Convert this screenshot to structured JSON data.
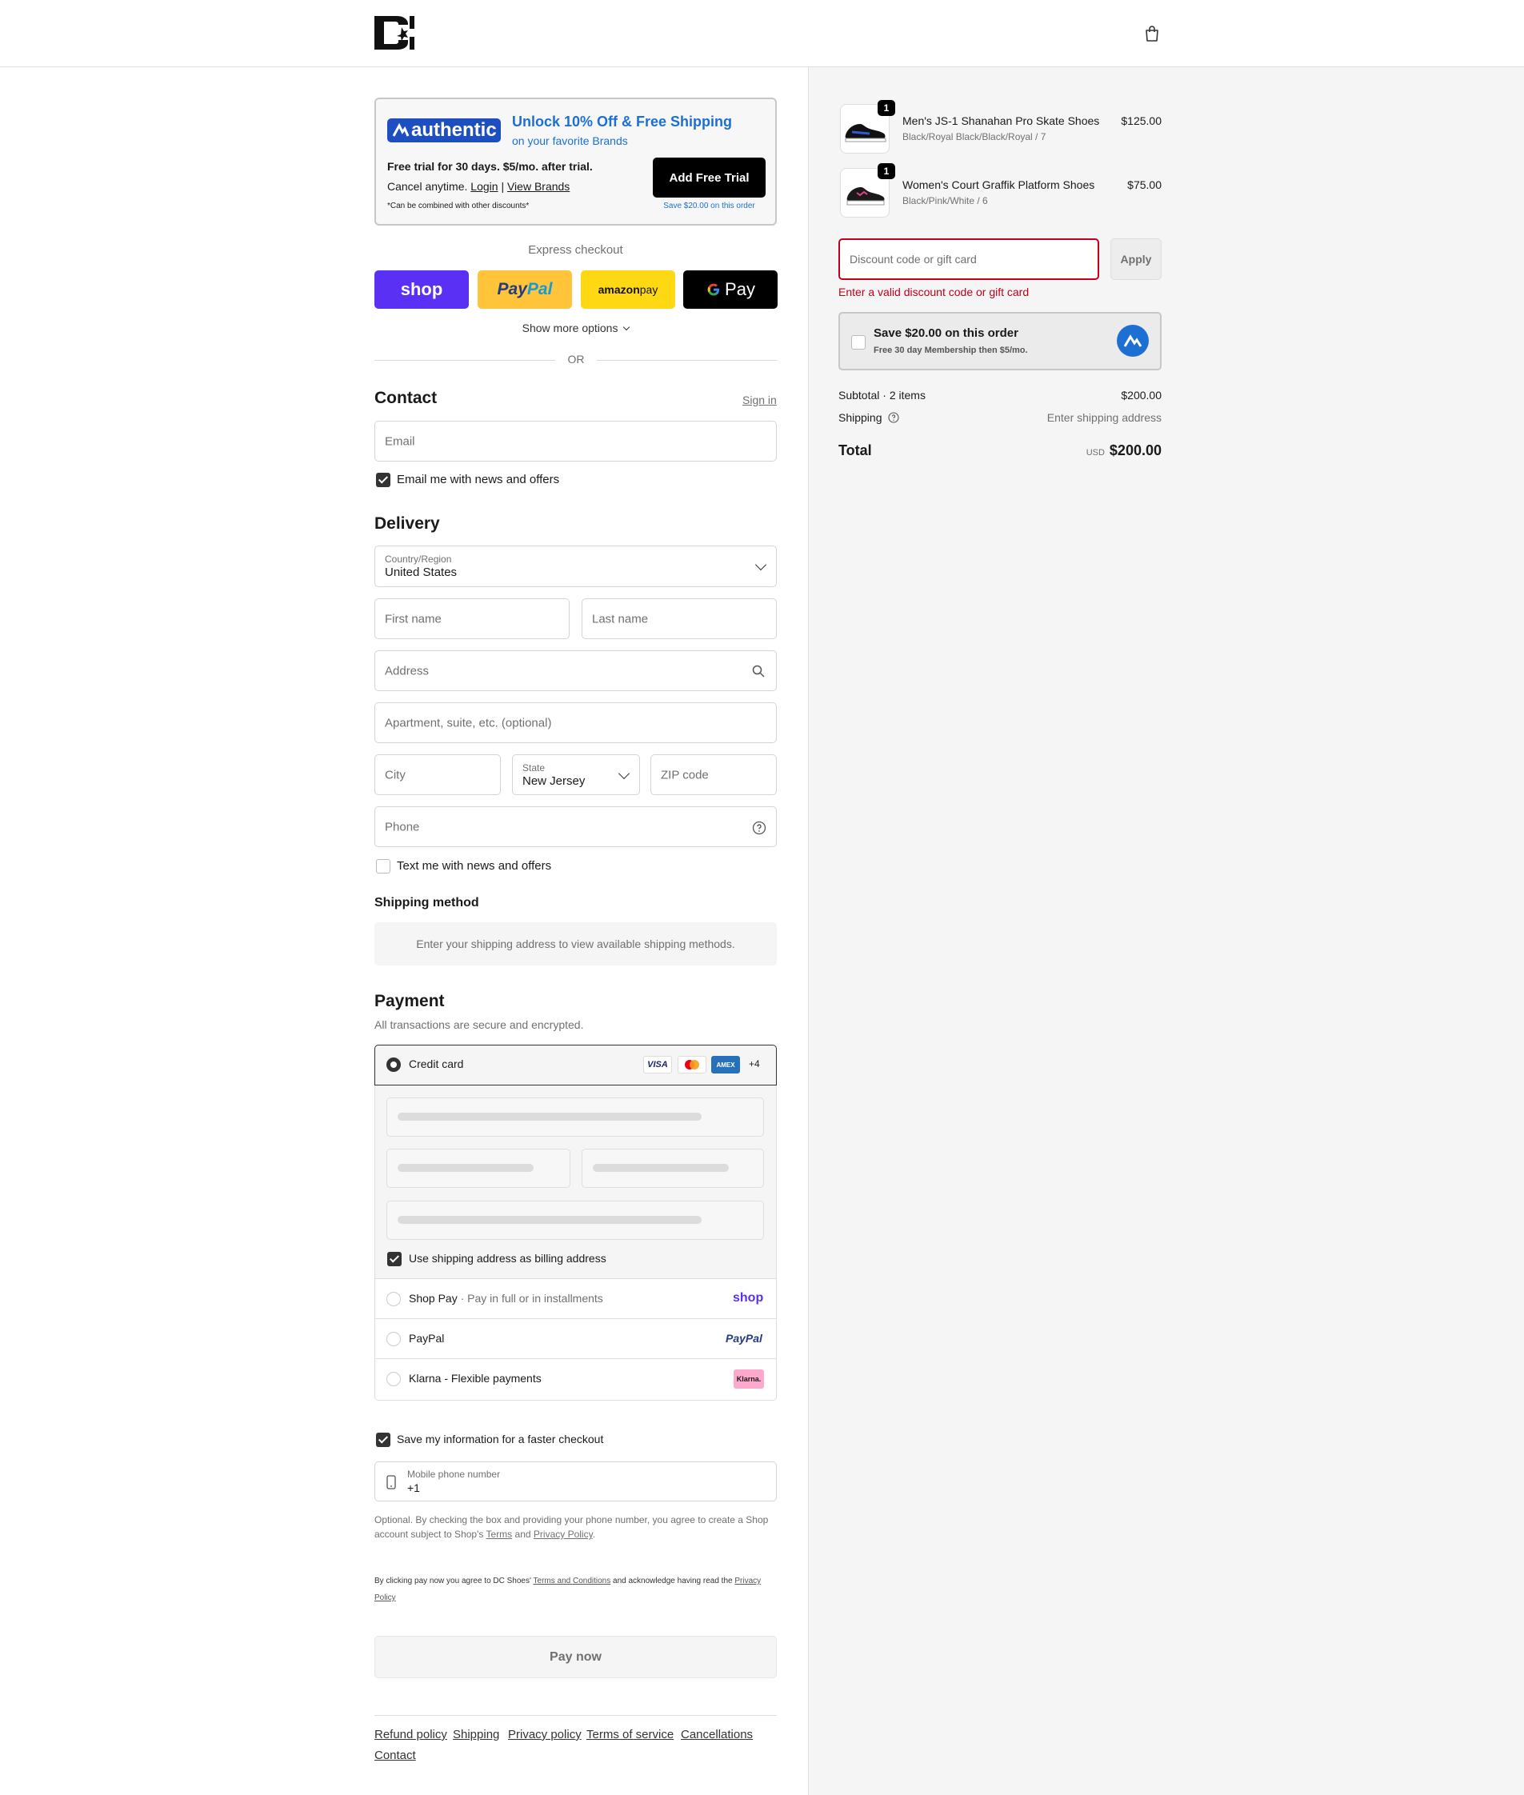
{
  "colors": {
    "accent": "#1d6fd4",
    "shop": "#5a31f4",
    "paypal": "#ffc439",
    "amazon": "#ffd814",
    "error": "#c0001a"
  },
  "header": {
    "logo_icon": "dc-logo",
    "bag_icon": "shopping-bag-icon"
  },
  "promo": {
    "logo_text": "authentic",
    "title": "Unlock 10% Off & Free Shipping",
    "subtitle": "on your favorite Brands",
    "line1": "Free trial for 30 days. $5/mo. after trial.",
    "line2_prefix": "Cancel anytime.",
    "login": "Login",
    "sep": "|",
    "view_brands": "View Brands",
    "note": "*Can be combined with other discounts*",
    "button": "Add Free Trial",
    "save_note": "Save $20.00 on this order"
  },
  "express": {
    "label": "Express checkout",
    "shop": "shop",
    "paypal_a": "Pay",
    "paypal_b": "Pal",
    "amazon_a": "amazon",
    "amazon_b": " pay",
    "gpay": "Pay",
    "show_more": "Show more options",
    "or": "OR"
  },
  "contact": {
    "heading": "Contact",
    "sign_in": "Sign in",
    "email_placeholder": "Email",
    "news_label": "Email me with news and offers",
    "news_checked": true
  },
  "delivery": {
    "heading": "Delivery",
    "country_label": "Country/Region",
    "country_value": "United States",
    "first_name": "First name",
    "last_name": "Last name",
    "address": "Address",
    "apartment": "Apartment, suite, etc. (optional)",
    "city": "City",
    "state_label": "State",
    "state_value": "New Jersey",
    "zip": "ZIP code",
    "phone": "Phone",
    "text_label": "Text me with news and offers",
    "text_checked": false
  },
  "shipping_method": {
    "heading": "Shipping method",
    "notice": "Enter your shipping address to view available shipping methods."
  },
  "payment": {
    "heading": "Payment",
    "subtitle": "All transactions are secure and encrypted.",
    "credit_card": "Credit card",
    "cards": [
      "VISA",
      "MC",
      "AMEX"
    ],
    "more_cards": "+4",
    "billing_label": "Use shipping address as billing address",
    "billing_checked": true,
    "shop_pay": "Shop Pay",
    "shop_pay_desc": "Pay in full or in installments",
    "shop_pay_logo": "shop",
    "paypal": "PayPal",
    "paypal_logo": "PayPal",
    "klarna": "Klarna - Flexible payments",
    "klarna_logo": "Klarna."
  },
  "save_info": {
    "label": "Save my information for a faster checkout",
    "checked": true,
    "mobile_label": "Mobile phone number",
    "mobile_value": "+1",
    "legal_prefix": "Optional. By checking the box and providing your phone number, you agree to create a Shop account subject to Shop's",
    "terms": "Terms",
    "and": "and",
    "privacy": "Privacy Policy",
    "period": "."
  },
  "agreement": {
    "prefix": "By clicking pay now you agree to DC Shoes'",
    "terms": "Terms and Conditions",
    "middle": "and acknowledge having read the",
    "privacy": "Privacy Policy"
  },
  "pay_button": "Pay now",
  "footer_links": [
    "Refund policy",
    "Shipping",
    "Privacy policy",
    "Terms of service",
    "Cancellations",
    "Contact"
  ],
  "order": {
    "items": [
      {
        "name": "Men's JS-1 Shanahan Pro Skate Shoes",
        "variant": "Black/Royal Black/Black/Royal / 7",
        "price": "$125.00",
        "qty": "1"
      },
      {
        "name": "Women's Court Graffik Platform Shoes",
        "variant": "Black/Pink/White / 6",
        "price": "$75.00",
        "qty": "1"
      }
    ],
    "discount_placeholder": "Discount code or gift card",
    "apply": "Apply",
    "discount_error": "Enter a valid discount code or gift card",
    "save_title": "Save $20.00 on this order",
    "save_sub": "Free 30 day Membership then $5/mo.",
    "subtotal_label": "Subtotal · 2 items",
    "subtotal_value": "$200.00",
    "shipping_label": "Shipping",
    "shipping_value": "Enter shipping address",
    "total_label": "Total",
    "currency": "USD",
    "total_value": "$200.00"
  }
}
